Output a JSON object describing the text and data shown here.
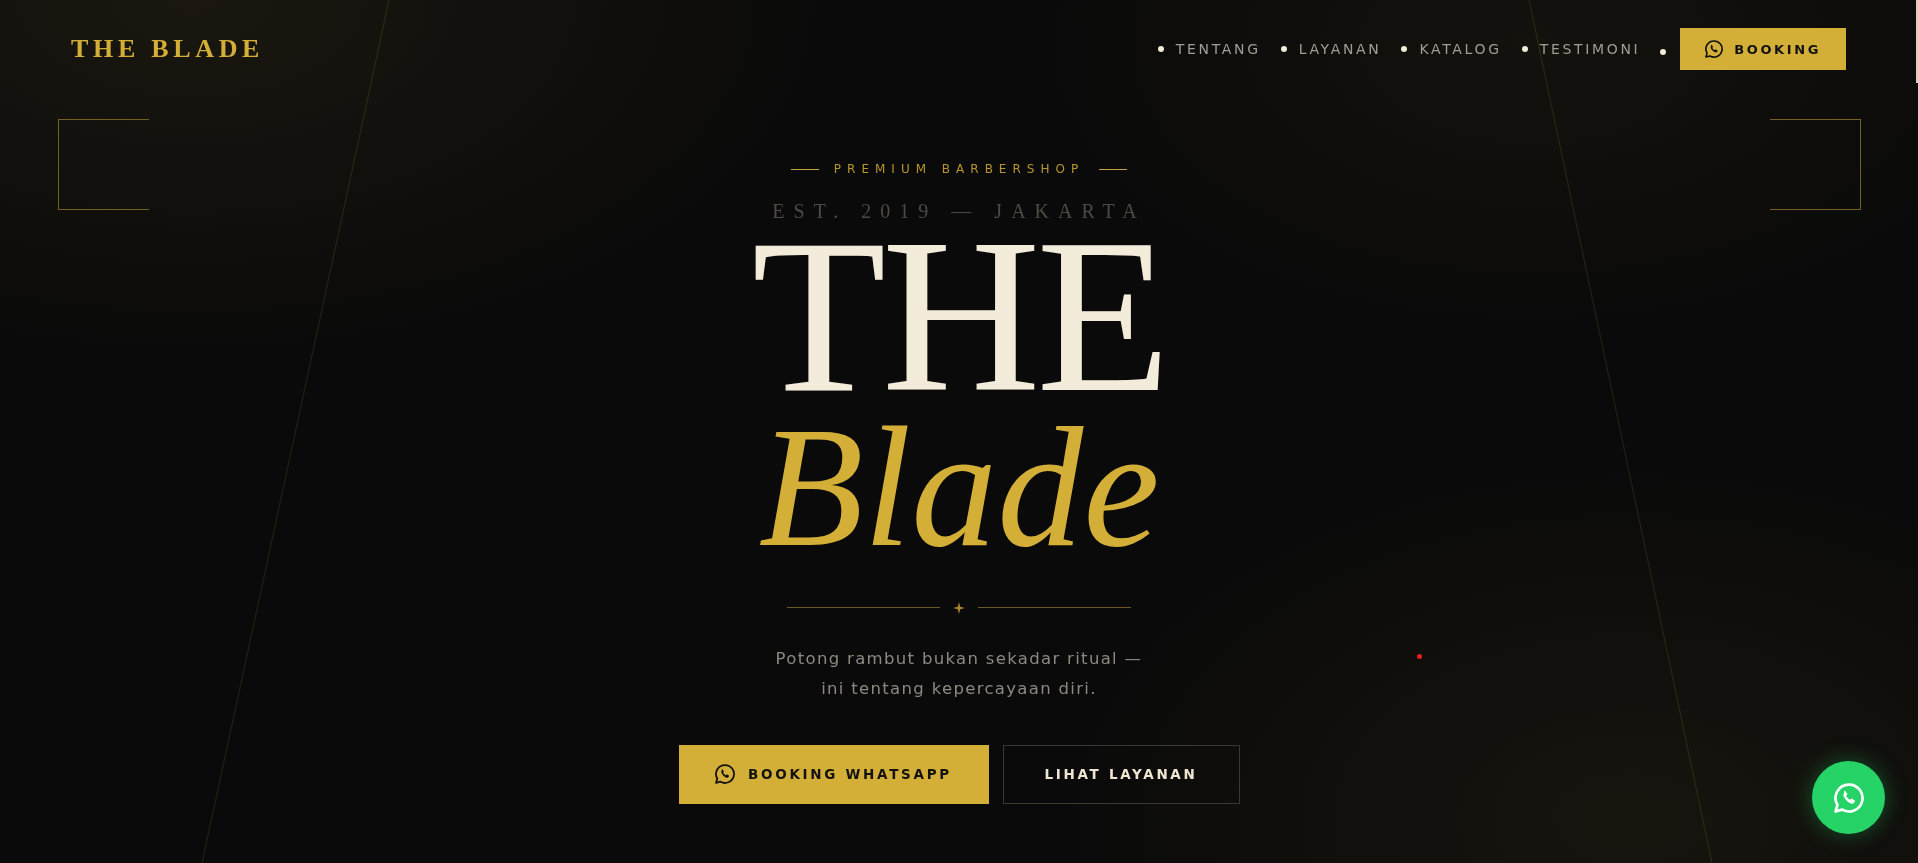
{
  "brand": {
    "logo": "THE BLADE"
  },
  "nav": {
    "links": [
      {
        "label": "TENTANG"
      },
      {
        "label": "LAYANAN"
      },
      {
        "label": "KATALOG"
      },
      {
        "label": "TESTIMONI"
      }
    ],
    "booking_button": {
      "label": "BOOKING"
    }
  },
  "hero": {
    "eyebrow": "PREMIUM BARBERSHOP",
    "established": "EST. 2019 — JAKARTA",
    "title_line_1": "THE",
    "title_line_2": "Blade",
    "tagline": "Potong rambut bukan sekadar ritual —\nini tentang kepercayaan diri.",
    "buttons": [
      {
        "label": "BOOKING WHATSAPP",
        "kind": "primary"
      },
      {
        "label": "LIHAT LAYANAN",
        "kind": "secondary"
      }
    ]
  }
}
